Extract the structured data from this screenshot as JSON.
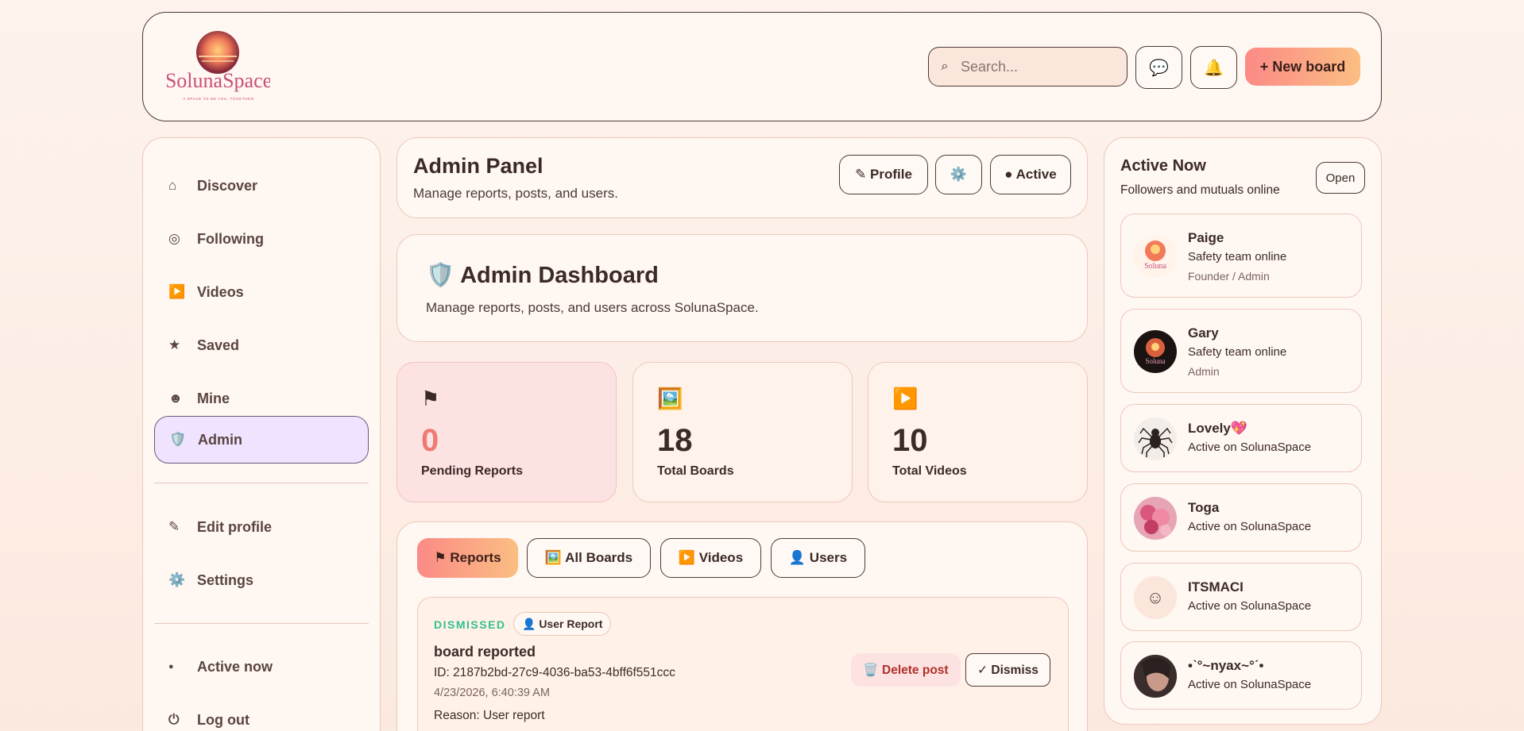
{
  "header": {
    "logo_text": "SolunaSpace",
    "logo_tagline": "A SPACE TO BE YOU, TOGETHER",
    "search_placeholder": "Search...",
    "search_icon": "search-icon",
    "messages_icon": "💬",
    "bell_icon": "🔔",
    "new_board_label": "+ New board"
  },
  "sidebar": {
    "items": [
      {
        "icon": "⌂",
        "label": "Discover"
      },
      {
        "icon": "◎",
        "label": "Following"
      },
      {
        "icon": "▶️",
        "label": "Videos"
      },
      {
        "icon": "★",
        "label": "Saved"
      },
      {
        "icon": "☻",
        "label": "Mine"
      },
      {
        "icon": "🛡️",
        "label": "Admin"
      }
    ],
    "secondary": [
      {
        "icon": "✎",
        "label": "Edit profile"
      },
      {
        "icon": "⚙️",
        "label": "Settings"
      }
    ],
    "footer": [
      {
        "icon": "●",
        "label": "Active now"
      },
      {
        "icon": "⏻",
        "label": "Log out"
      }
    ]
  },
  "panel": {
    "title": "Admin Panel",
    "subtitle": "Manage reports, posts, and users.",
    "profile_label": "✎ Profile",
    "settings_icon": "⚙️",
    "active_label": "● Active"
  },
  "dashboard": {
    "title": "🛡️ Admin Dashboard",
    "subtitle": "Manage reports, posts, and users across SolunaSpace."
  },
  "stats": [
    {
      "icon": "⚑",
      "value": "0",
      "label": "Pending Reports"
    },
    {
      "icon": "🖼️",
      "value": "18",
      "label": "Total Boards"
    },
    {
      "icon": "▶️",
      "value": "10",
      "label": "Total Videos"
    }
  ],
  "tabs": [
    {
      "label": "⚑ Reports"
    },
    {
      "label": "🖼️ All Boards"
    },
    {
      "label": "▶️ Videos"
    },
    {
      "label": "👤 Users"
    }
  ],
  "report": {
    "status": "DISMISSED",
    "badge": "👤 User Report",
    "title": "board reported",
    "id": "ID: 2187b2bd-27c9-4036-ba53-4bff6f551ccc",
    "date": "4/23/2026, 6:40:39 AM",
    "reason": "Reason: User report",
    "delete_label": "🗑️ Delete post",
    "dismiss_label": "✓ Dismiss"
  },
  "active_now": {
    "title": "Active Now",
    "subtitle": "Followers and mutuals online",
    "open_label": "Open",
    "users": [
      {
        "name": "Paige",
        "status": "Safety team online",
        "role": "Founder / Admin"
      },
      {
        "name": "Gary",
        "status": "Safety team online",
        "role": "Admin"
      },
      {
        "name": "Lovely💖",
        "status": "Active on SolunaSpace",
        "role": ""
      },
      {
        "name": "Toga",
        "status": "Active on SolunaSpace",
        "role": ""
      },
      {
        "name": "ITSMACI",
        "status": "Active on SolunaSpace",
        "role": ""
      },
      {
        "name": "•ˋ°~nyax~°ˊ•",
        "status": "Active on SolunaSpace",
        "role": ""
      }
    ]
  },
  "colors": {
    "accent_gradient_start": "#fb8a86",
    "accent_gradient_end": "#fbbe82",
    "admin_active_bg": "#efe3ff",
    "dismissed_green": "#34c08c"
  }
}
